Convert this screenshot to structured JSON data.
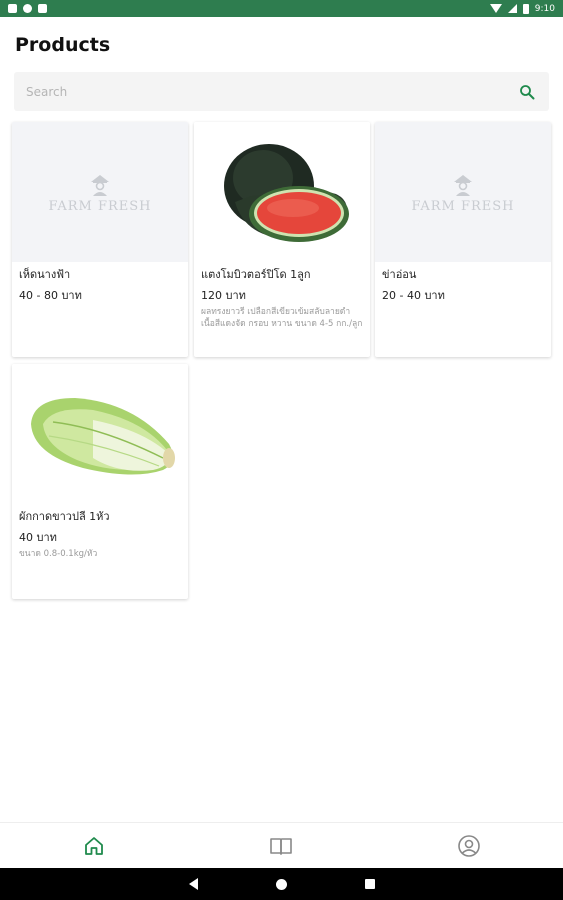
{
  "status_bar": {
    "time": "9:10",
    "icons": [
      "notification-icon",
      "circle-icon",
      "sim-icon"
    ],
    "right_icons": [
      "wifi-icon",
      "signal-icon",
      "battery-icon"
    ]
  },
  "page": {
    "title": "Products"
  },
  "search": {
    "placeholder": "Search",
    "value": "",
    "icon": "search-icon"
  },
  "products": [
    {
      "name": "เห็ดนางฟ้า",
      "price": "40 - 80 บาท",
      "description": "",
      "image": "farm-fresh-placeholder"
    },
    {
      "name": "แตงโมบิวตอร์ปิโด 1ลูก",
      "price": "120 บาท",
      "description": "ผลทรงยาวรี เปลือกสีเขียวเข้มสลับลายดำ เนื้อสีแดงจัด กรอบ หวาน ขนาด 4-5 กก./ลูก",
      "image": "watermelon"
    },
    {
      "name": "ข่าอ่อน",
      "price": "20 - 40 บาท",
      "description": "",
      "image": "farm-fresh-placeholder"
    },
    {
      "name": "ผักกาดขาวปลี 1หัว",
      "price": "40 บาท",
      "description": "ขนาด 0.8-0.1kg/หัว",
      "image": "napa-cabbage"
    }
  ],
  "placeholder_logo": {
    "text": "FARM FRESH"
  },
  "bottom_nav": {
    "items": [
      "home-icon",
      "book-icon",
      "profile-icon"
    ],
    "active": "home-icon"
  },
  "colors": {
    "brand": "#2e7d4f",
    "accent": "#1f8a4c",
    "placeholder_bg": "#f3f4f7"
  }
}
